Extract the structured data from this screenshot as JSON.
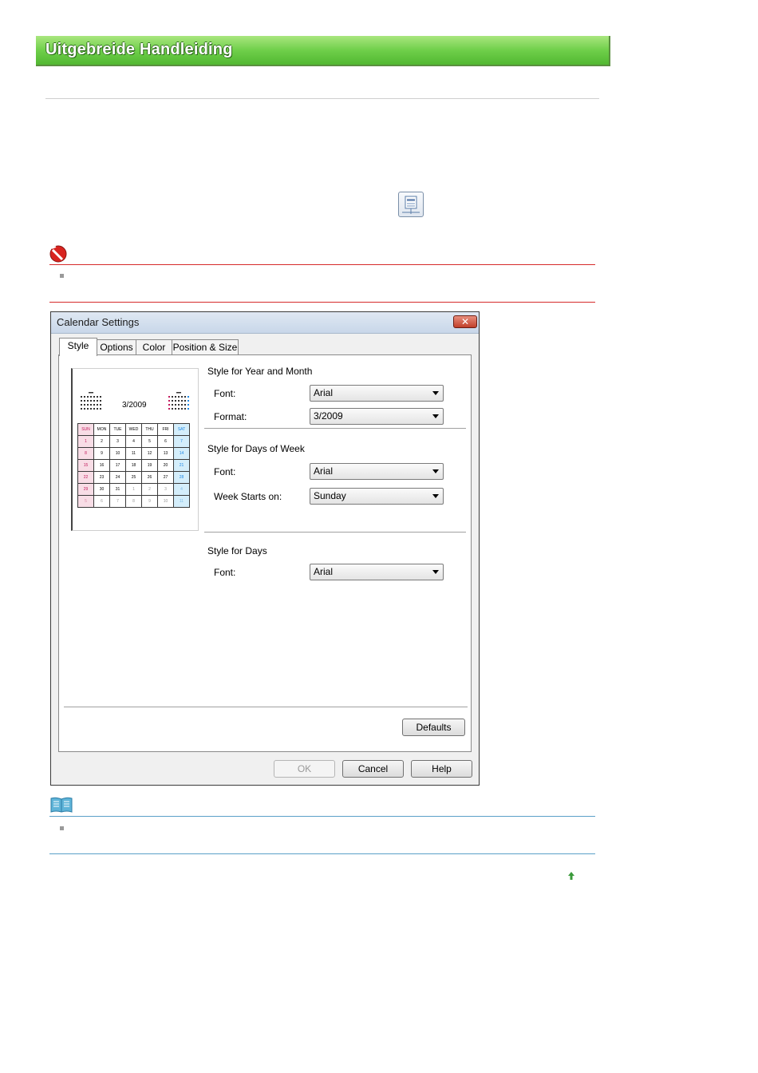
{
  "header": {
    "title": "Uitgebreide Handleiding"
  },
  "icons": {
    "toolbar": "calendar-settings-icon",
    "important": "important-prohibited-icon",
    "note": "note-book-icon",
    "page_top": "page-top-arrow-icon"
  },
  "colors": {
    "banner": "#6fcf4a",
    "important_rule": "#d62b2b",
    "note_rule": "#5aa0c8"
  },
  "dialog": {
    "title": "Calendar Settings",
    "close_glyph": "✕",
    "tabs": [
      {
        "label": "Style",
        "active": true
      },
      {
        "label": "Options",
        "active": false
      },
      {
        "label": "Color",
        "active": false
      },
      {
        "label": "Position & Size",
        "active": false
      }
    ],
    "preview": {
      "month": "3/2009",
      "headers": [
        "SUN",
        "MON",
        "TUE",
        "WED",
        "THU",
        "FRI",
        "SAT"
      ],
      "weeks": [
        [
          "1",
          "2",
          "3",
          "4",
          "5",
          "6",
          "7"
        ],
        [
          "8",
          "9",
          "10",
          "11",
          "12",
          "13",
          "14"
        ],
        [
          "15",
          "16",
          "17",
          "18",
          "19",
          "20",
          "21"
        ],
        [
          "22",
          "23",
          "24",
          "25",
          "26",
          "27",
          "28"
        ],
        [
          "29",
          "30",
          "31",
          "1",
          "2",
          "3",
          "4"
        ],
        [
          "5",
          "6",
          "7",
          "8",
          "9",
          "10",
          "11"
        ]
      ]
    },
    "year_month": {
      "heading": "Style for Year and Month",
      "font_label": "Font:",
      "font_value": "Arial",
      "format_label": "Format:",
      "format_value": "3/2009"
    },
    "days_of_week": {
      "heading": "Style for Days of Week",
      "font_label": "Font:",
      "font_value": "Arial",
      "week_starts_label": "Week Starts on:",
      "week_starts_value": "Sunday"
    },
    "days": {
      "heading": "Style for Days",
      "font_label": "Font:",
      "font_value": "Arial"
    },
    "buttons": {
      "defaults": "Defaults",
      "ok": "OK",
      "cancel": "Cancel",
      "help": "Help"
    }
  }
}
